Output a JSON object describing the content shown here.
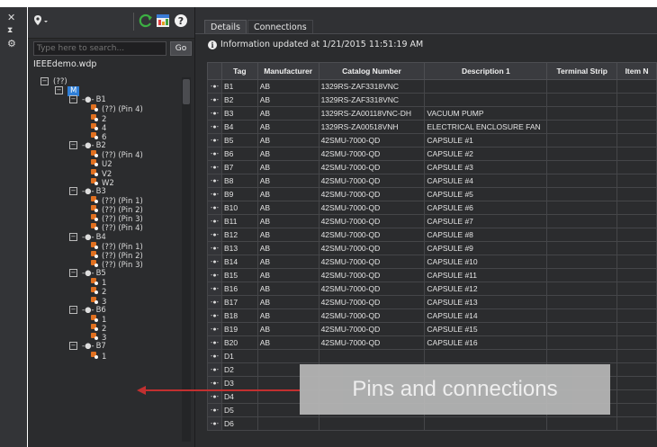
{
  "left_toolbar": {
    "close_glyph": "✕",
    "collapse_glyph": "⧗",
    "settings_glyph": "⚙"
  },
  "project_panel": {
    "location_icon": "location-pin-icon",
    "search": {
      "placeholder": "Type here to search...",
      "value": ""
    },
    "go_label": "Go",
    "project_name": "IEEEdemo.wdp",
    "tree": [
      {
        "text": "(??)",
        "kind": "expander",
        "level": 0
      },
      {
        "text": "M",
        "kind": "expander-selected",
        "level": 1
      },
      {
        "text": "B1",
        "kind": "device",
        "level": 2
      },
      {
        "text": "(??) (Pin 4)",
        "kind": "pin",
        "level": 3
      },
      {
        "text": "2",
        "kind": "pin",
        "level": 3
      },
      {
        "text": "4",
        "kind": "pin",
        "level": 3
      },
      {
        "text": "6",
        "kind": "pin",
        "level": 3
      },
      {
        "text": "B2",
        "kind": "device",
        "level": 2
      },
      {
        "text": "(??) (Pin 4)",
        "kind": "pin",
        "level": 3
      },
      {
        "text": "U2",
        "kind": "pin",
        "level": 3
      },
      {
        "text": "V2",
        "kind": "pin",
        "level": 3
      },
      {
        "text": "W2",
        "kind": "pin",
        "level": 3
      },
      {
        "text": "B3",
        "kind": "device",
        "level": 2
      },
      {
        "text": "(??) (Pin 1)",
        "kind": "pin",
        "level": 3
      },
      {
        "text": "(??) (Pin 2)",
        "kind": "pin",
        "level": 3
      },
      {
        "text": "(??) (Pin 3)",
        "kind": "pin",
        "level": 3
      },
      {
        "text": "(??) (Pin 4)",
        "kind": "pin",
        "level": 3
      },
      {
        "text": "B4",
        "kind": "device",
        "level": 2
      },
      {
        "text": "(??) (Pin 1)",
        "kind": "pin",
        "level": 3
      },
      {
        "text": "(??) (Pin 2)",
        "kind": "pin",
        "level": 3
      },
      {
        "text": "(??) (Pin 3)",
        "kind": "pin",
        "level": 3
      },
      {
        "text": "B5",
        "kind": "device",
        "level": 2
      },
      {
        "text": "1",
        "kind": "pin",
        "level": 3
      },
      {
        "text": "2",
        "kind": "pin",
        "level": 3
      },
      {
        "text": "3",
        "kind": "pin",
        "level": 3
      },
      {
        "text": "B6",
        "kind": "device",
        "level": 2
      },
      {
        "text": "1",
        "kind": "pin",
        "level": 3
      },
      {
        "text": "2",
        "kind": "pin",
        "level": 3
      },
      {
        "text": "3",
        "kind": "pin",
        "level": 3
      },
      {
        "text": "B7",
        "kind": "device",
        "level": 2
      },
      {
        "text": "1",
        "kind": "pin",
        "level": 3
      }
    ]
  },
  "tabs": [
    {
      "label": "Details",
      "active": true
    },
    {
      "label": "Connections",
      "active": false
    }
  ],
  "info": {
    "text": "Information updated at  1/21/2015 11:51:19 AM"
  },
  "grid": {
    "columns": [
      "",
      "Tag",
      "Manufacturer",
      "Catalog Number",
      "Description 1",
      "Terminal Strip",
      "Item N"
    ],
    "rows": [
      [
        "B1",
        "AB",
        "1329RS-ZAF3318VNC",
        ""
      ],
      [
        "B2",
        "AB",
        "1329RS-ZAF3318VNC",
        ""
      ],
      [
        "B3",
        "AB",
        "1329RS-ZA00118VNC-DH",
        "VACUUM PUMP"
      ],
      [
        "B4",
        "AB",
        "1329RS-ZA00518VNH",
        "ELECTRICAL ENCLOSURE FAN"
      ],
      [
        "B5",
        "AB",
        "42SMU-7000-QD",
        "CAPSULE #1"
      ],
      [
        "B6",
        "AB",
        "42SMU-7000-QD",
        "CAPSULE #2"
      ],
      [
        "B7",
        "AB",
        "42SMU-7000-QD",
        "CAPSULE #3"
      ],
      [
        "B8",
        "AB",
        "42SMU-7000-QD",
        "CAPSULE #4"
      ],
      [
        "B9",
        "AB",
        "42SMU-7000-QD",
        "CAPSULE #5"
      ],
      [
        "B10",
        "AB",
        "42SMU-7000-QD",
        "CAPSULE #6"
      ],
      [
        "B11",
        "AB",
        "42SMU-7000-QD",
        "CAPSULE #7"
      ],
      [
        "B12",
        "AB",
        "42SMU-7000-QD",
        "CAPSULE #8"
      ],
      [
        "B13",
        "AB",
        "42SMU-7000-QD",
        "CAPSULE #9"
      ],
      [
        "B14",
        "AB",
        "42SMU-7000-QD",
        "CAPSULE #10"
      ],
      [
        "B15",
        "AB",
        "42SMU-7000-QD",
        "CAPSULE #11"
      ],
      [
        "B16",
        "AB",
        "42SMU-7000-QD",
        "CAPSULE #12"
      ],
      [
        "B17",
        "AB",
        "42SMU-7000-QD",
        "CAPSULE #13"
      ],
      [
        "B18",
        "AB",
        "42SMU-7000-QD",
        "CAPSULE #14"
      ],
      [
        "B19",
        "AB",
        "42SMU-7000-QD",
        "CAPSULE #15"
      ],
      [
        "B20",
        "AB",
        "42SMU-7000-QD",
        "CAPSULE #16"
      ],
      [
        "D1",
        "",
        "",
        ""
      ],
      [
        "D2",
        "",
        "",
        ""
      ],
      [
        "D3",
        "",
        "",
        ""
      ],
      [
        "D4",
        "",
        "",
        ""
      ],
      [
        "D5",
        "",
        "",
        ""
      ],
      [
        "D6",
        "",
        "",
        ""
      ]
    ]
  },
  "callout": {
    "text": "Pins and connections"
  },
  "colors": {
    "accent": "#2f7fd8",
    "callout_bg": "#b8b8b8",
    "arrow": "#c23030",
    "pin": "#e07020",
    "refresh": "#3cb043"
  }
}
